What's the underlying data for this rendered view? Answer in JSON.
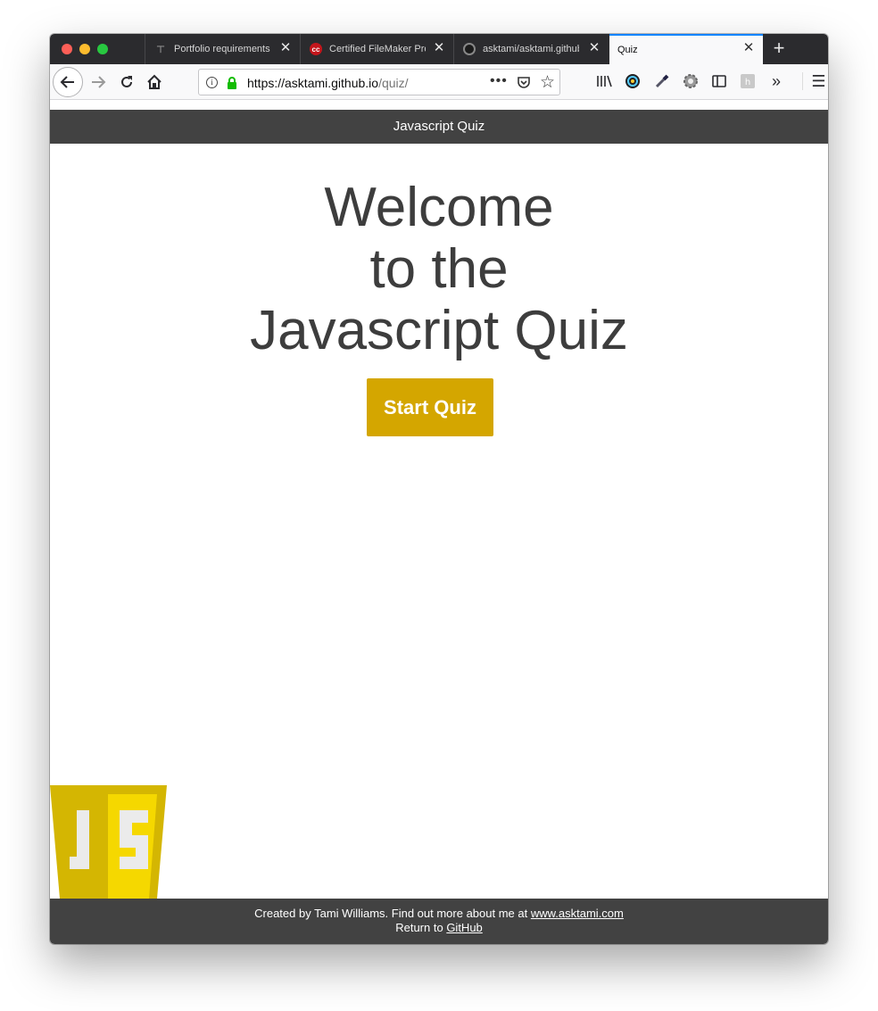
{
  "tabs": [
    {
      "title": "Portfolio requirements",
      "favicon": "portfolio-icon"
    },
    {
      "title": "Certified FileMaker Pro",
      "favicon": "cc-icon"
    },
    {
      "title": "asktami/asktami.github",
      "favicon": "github-icon"
    },
    {
      "title": "Quiz",
      "favicon": "none"
    }
  ],
  "url": {
    "host": "https://asktami.github.io",
    "path": "/quiz/"
  },
  "header": {
    "title": "Javascript Quiz"
  },
  "welcome": {
    "line1": "Welcome",
    "line2": "to the",
    "line3": "Javascript Quiz"
  },
  "start_button": "Start Quiz",
  "footer": {
    "created_by": "Created by Tami Williams. Find out more about me at ",
    "site_link": "www.asktami.com",
    "return_prefix": "Return to ",
    "github_link": "GitHub"
  },
  "colors": {
    "header_bg": "#424242",
    "button_bg": "#d4a600",
    "heading_text": "#3d3d3d"
  }
}
